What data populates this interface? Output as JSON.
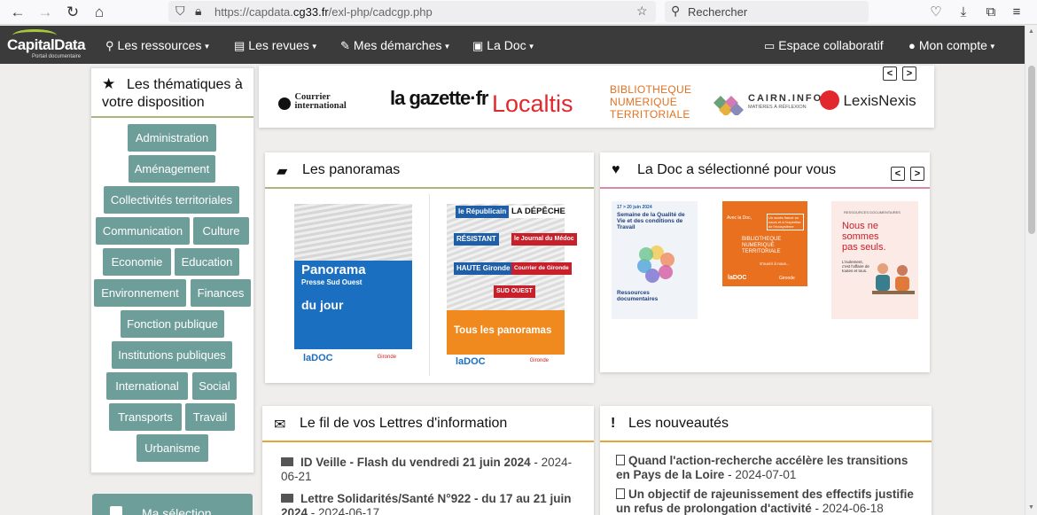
{
  "browser": {
    "url_prefix": "https://capdata.",
    "url_domain": "cg33.fr",
    "url_path": "/exl-php/cadcgp.php",
    "search_placeholder": "Rechercher"
  },
  "navbar": {
    "logo_text": "CapitalData",
    "logo_sub": "Portail documentaire",
    "items": [
      {
        "label": "Les ressources",
        "icon": "search-icon"
      },
      {
        "label": "Les revues",
        "icon": "newspaper-icon"
      },
      {
        "label": "Mes démarches",
        "icon": "edit-icon"
      },
      {
        "label": "La Doc",
        "icon": "id-card-icon"
      },
      {
        "label": "Espace collaboratif",
        "icon": "monitor-icon"
      },
      {
        "label": "Mon compte",
        "icon": "user-icon"
      }
    ]
  },
  "sidebar": {
    "title": "Les thématiques à votre disposition",
    "tags": [
      "Administration",
      "Aménagement",
      "Collectivités territoriales",
      "Communication",
      "Culture",
      "Economie",
      "Education",
      "Environnement",
      "Finances",
      "Fonction publique",
      "Institutions publiques",
      "International",
      "Social",
      "Transports",
      "Travail",
      "Urbanisme"
    ],
    "next_block_title": "Ma sélection"
  },
  "partners": {
    "prev": "<",
    "next": ">",
    "logos": [
      "Courrier international",
      "la gazette·fr",
      "Localtis",
      "BIBLIOTHEQUE NUMERIQUE TERRITORIALE",
      "CAIRN.INFO",
      "MATIÈRES À RÉFLEXION",
      "LexisNexis"
    ]
  },
  "panoramas": {
    "title": "Les panoramas",
    "jour": {
      "title": "Panorama",
      "sub": "Presse Sud Ouest",
      "label": "du jour",
      "brand": "laDOC",
      "dept": "Gironde"
    },
    "tous": {
      "mastheads": [
        "le Républicain",
        "LA DÉPÊCHE",
        "RÉSISTANT",
        "le Journal du Médoc",
        "HAUTE Gironde",
        "Courrier de Gironde",
        "SUD OUEST"
      ],
      "label": "Tous les panoramas",
      "brand": "laDOC",
      "dept": "Gironde"
    }
  },
  "selection": {
    "title": "La Doc a sélectionné pour vous",
    "prev": "<",
    "next": ">",
    "items": [
      {
        "date": "17 > 20 juin 2024",
        "title": "Semaine de la Qualité de Vie et des conditions de Travail",
        "footer": "Ressources documentaires"
      },
      {
        "head": "Avec la Doc,",
        "note": "Un accès fiancé au cours et à l'expertise de l'écosystème",
        "title": "BIBLIOTHEQUE NUMERIQUE TERRITORIALE",
        "link": "S'ouvrir à nous...",
        "brand": "laDOC",
        "dept": "Gironde"
      },
      {
        "tag": "RESSOURCES DOCUMENTAIRES",
        "title": "Nous ne sommes pas seuls.",
        "text": "L'isolement, c'est l'affaire de toutes et tous."
      }
    ]
  },
  "lettres": {
    "title": "Le fil de vos Lettres d'information",
    "items": [
      {
        "title": "ID Veille - Flash du vendredi 21 juin 2024",
        "date": "2024-06-21"
      },
      {
        "title": "Lettre Solidarités/Santé N°922 - du 17 au 21 juin 2024",
        "date": "2024-06-17"
      }
    ]
  },
  "nouveautes": {
    "title": "Les nouveautés",
    "items": [
      {
        "title": "Quand l'action-recherche accélère les transitions en Pays de la Loire",
        "date": "2024-07-01"
      },
      {
        "title": "Un objectif de rajeunissement des effectifs justifie un refus de prolongation d'activité",
        "date": "2024-06-18"
      }
    ]
  },
  "colors": {
    "navbar": "#3b3b3b",
    "tag": "#6e9e9a",
    "accent_green": "#a9b87a",
    "accent_orange": "#e8a33a",
    "accent_pink": "#d98aa8"
  }
}
